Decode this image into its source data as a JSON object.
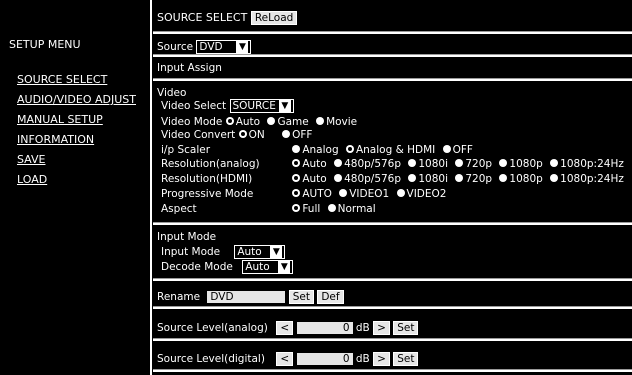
{
  "sidebar": {
    "title": "SETUP MENU",
    "items": [
      {
        "label": "SOURCE SELECT"
      },
      {
        "label": "AUDIO/VIDEO ADJUST"
      },
      {
        "label": "MANUAL SETUP"
      },
      {
        "label": "INFORMATION"
      },
      {
        "label": "SAVE"
      },
      {
        "label": "LOAD"
      }
    ]
  },
  "header": {
    "title": "SOURCE SELECT",
    "reload": "ReLoad"
  },
  "source": {
    "label": "Source",
    "value": "DVD"
  },
  "input_assign": {
    "label": "Input Assign"
  },
  "video": {
    "heading": "Video",
    "video_select": {
      "label": "Video Select",
      "value": "SOURCE"
    },
    "video_mode": {
      "label": "Video Mode",
      "options": [
        "Auto",
        "Game",
        "Movie"
      ],
      "selected": "Auto"
    },
    "video_convert": {
      "label": "Video Convert",
      "options": [
        "ON",
        "OFF"
      ],
      "selected": "ON"
    },
    "ip_scaler": {
      "label": "i/p Scaler",
      "options": [
        "Analog",
        "Analog & HDMI",
        "OFF"
      ],
      "selected": "Analog & HDMI"
    },
    "res_analog": {
      "label": "Resolution(analog)",
      "options": [
        "Auto",
        "480p/576p",
        "1080i",
        "720p",
        "1080p",
        "1080p:24Hz"
      ],
      "selected": "Auto"
    },
    "res_hdmi": {
      "label": "Resolution(HDMI)",
      "options": [
        "Auto",
        "480p/576p",
        "1080i",
        "720p",
        "1080p",
        "1080p:24Hz"
      ],
      "selected": "Auto"
    },
    "progressive": {
      "label": "Progressive Mode",
      "options": [
        "AUTO",
        "VIDEO1",
        "VIDEO2"
      ],
      "selected": "AUTO"
    },
    "aspect": {
      "label": "Aspect",
      "options": [
        "Full",
        "Normal"
      ],
      "selected": "Full"
    }
  },
  "input_mode": {
    "heading": "Input Mode",
    "input_mode": {
      "label": "Input Mode",
      "value": "Auto"
    },
    "decode_mode": {
      "label": "Decode Mode",
      "value": "Auto"
    }
  },
  "rename": {
    "label": "Rename",
    "value": "DVD",
    "set": "Set",
    "def": "Def"
  },
  "level_analog": {
    "label": "Source Level(analog)",
    "dec": "<",
    "value": "0",
    "unit": "dB",
    "inc": ">",
    "set": "Set"
  },
  "level_digital": {
    "label": "Source Level(digital)",
    "dec": "<",
    "value": "0",
    "unit": "dB",
    "inc": ">",
    "set": "Set"
  }
}
